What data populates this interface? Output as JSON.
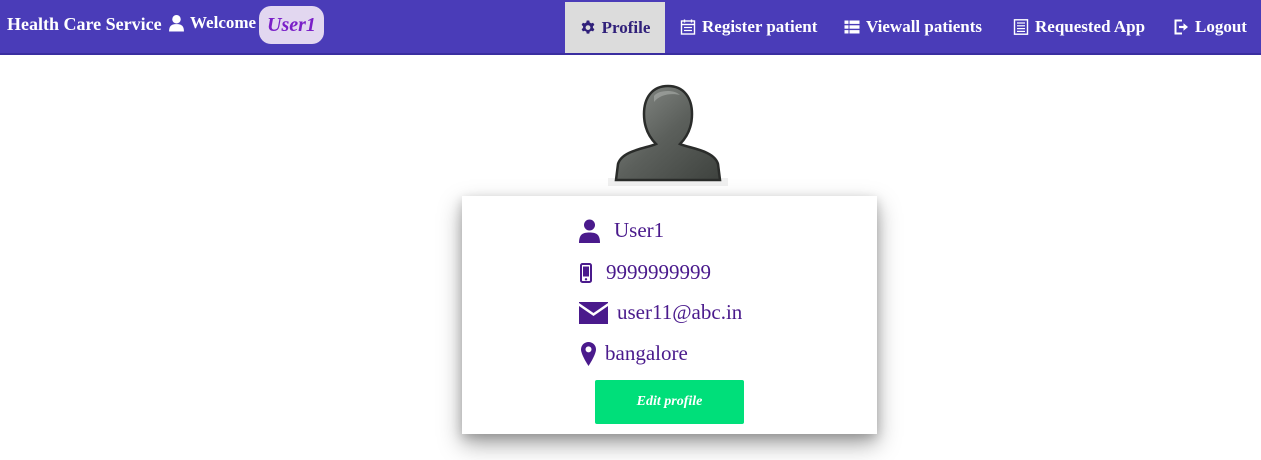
{
  "header": {
    "brand": "Health Care Service",
    "welcome": "Welcome",
    "username": "User1",
    "colors": {
      "navbar": "#4a3cb8",
      "active_tab": "#dcdcdc",
      "user_pill": "#e2d7f0"
    }
  },
  "nav": {
    "profile": "Profile",
    "register_patient": "Register patient",
    "viewall_patients": "Viewall patients",
    "requested_app": "Requested App",
    "logout": "Logout"
  },
  "profile": {
    "name": "User1",
    "phone": "9999999999",
    "email": "user11@abc.in",
    "location": "bangalore",
    "edit_label": "Edit profile",
    "colors": {
      "text": "#4a1a8c",
      "button": "#00df7a"
    }
  },
  "icons": {
    "user": "user-icon",
    "gear": "gear-icon",
    "register": "calendar-icon",
    "list": "list-icon",
    "requested": "document-list-icon",
    "logout": "logout-icon",
    "phone": "mobile-phone-icon",
    "email": "envelope-icon",
    "location": "map-marker-icon"
  }
}
